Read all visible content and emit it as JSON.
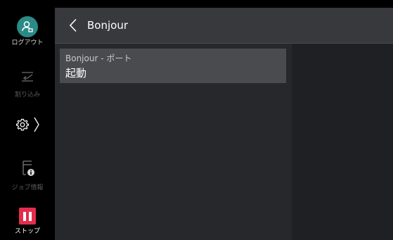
{
  "header": {
    "title": "Bonjour"
  },
  "sidebar": {
    "logout": {
      "label": "ログアウト",
      "icon": "user-logout-icon"
    },
    "interrupt": {
      "label": "割り込み",
      "icon": "interrupt-icon"
    },
    "settings": {
      "icon": "gear-icon"
    },
    "job_info": {
      "label": "ジョブ情報",
      "icon": "job-info-icon"
    },
    "stop": {
      "label": "ストップ",
      "icon": "pause-icon"
    }
  },
  "list": {
    "items": [
      {
        "title": "Bonjour - ポート",
        "value": "起動"
      }
    ]
  },
  "colors": {
    "logout_accent": "#2a8a86",
    "stop_accent": "#e32d4e",
    "header_bg": "#38393c",
    "panel_bg": "#27282b",
    "item_bg": "#4a4b4f"
  }
}
